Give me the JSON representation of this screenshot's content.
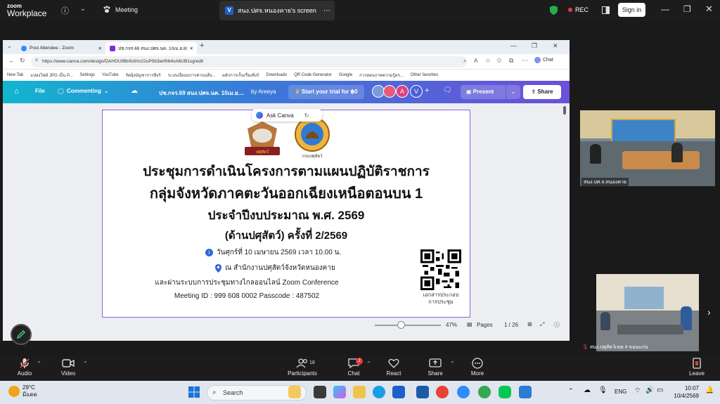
{
  "zoom": {
    "logo_line1": "zoom",
    "logo_line2": "Workplace",
    "meeting_label": "Meeting",
    "share_label": "สนง.ปศจ.หนองคาย's screen",
    "rec_label": "REC",
    "signin_label": "Sign in",
    "toolbar": {
      "audio": "Audio",
      "video": "Video",
      "participants": "Participants",
      "participants_count": "18",
      "chat": "Chat",
      "chat_badge": "2",
      "react": "React",
      "share": "Share",
      "more": "More",
      "leave": "Leave"
    },
    "participants": [
      {
        "name": "สนง.ปศ.จ.หนองคาย"
      },
      {
        "name": "สนง.ปศุสัตว์เขต 4 ขอนแก่น"
      }
    ]
  },
  "browser": {
    "tabs": [
      {
        "label": "Post Attendee - Zoom"
      },
      {
        "label": "ปช.กจร.69 สนง.ปศจ.นค. 10เม.ย.69 - P"
      }
    ],
    "url": "https://www.canva.com/design/DAHGU9Bnfo0/m22uP0b3wrfh64vA6UB1sg/edit",
    "chat_label": "Chat",
    "bookmarks": [
      "New Tab",
      "แปลงไฟล์ JPG เป็น P...",
      "Settings",
      "YouTube",
      "รัตยุ้งบัญชาการสิ่งร้",
      "ระบบเงื่อนบการค่าบนสิ่ง...",
      "ผลักการเก็บเรื่องสิ่งร้",
      "Downloads",
      "QR Code Generator",
      "Google",
      "การสอบภาคความรู้ตร...",
      "Other favorites"
    ],
    "canva": {
      "file": "File",
      "commenting": "Commenting",
      "doc_title": "ปช.กจร.69 สนง.ปศจ.นค. 10เม.ย....",
      "by": "by Areeya",
      "trial": "Start your trial for ฿0",
      "avatar_a": "A",
      "avatar_v": "V",
      "present": "Present",
      "share": "Share",
      "ask_canva": "Ask Canva",
      "zoom_pct": "47%",
      "pages": "Pages",
      "page_counter": "1 / 26"
    }
  },
  "slide": {
    "logo_left_text": "ปศุสัตว์",
    "logo_right_text": "กรมปศุสัตว์",
    "title1": "ประชุมการดำเนินโครงการตามแผนปฏิบัติราชการ",
    "title2": "กลุ่มจังหวัดภาคตะวันออกเฉียงเหนือตอนบน 1",
    "title3": "ประจำปีงบประมาณ พ.ศ. 2569",
    "title4": "(ด้านปศุสัตว์) ครั้งที่ 2/2569",
    "date_line": "วันศุกร์ที่ 10 เมษายน 2569 เวลา 10.00 น.",
    "place_line": "ณ สำนักงานปศุสัตว์จังหวัดหนองคาย",
    "online_line": "และผ่านระบบการประชุมทางไกลออนไลน์ Zoom Conference",
    "meeting_id_line": "Meeting ID : 999 608 0002 Passcode : 487502",
    "qr_caption1": "เอกสารประกอบ",
    "qr_caption2": "การประชุม"
  },
  "taskbar": {
    "weather_temp": "29°C",
    "weather_desc": "มีแดด",
    "search_placeholder": "Search",
    "lang": "ENG",
    "time": "10:07",
    "date": "10/4/2569"
  }
}
